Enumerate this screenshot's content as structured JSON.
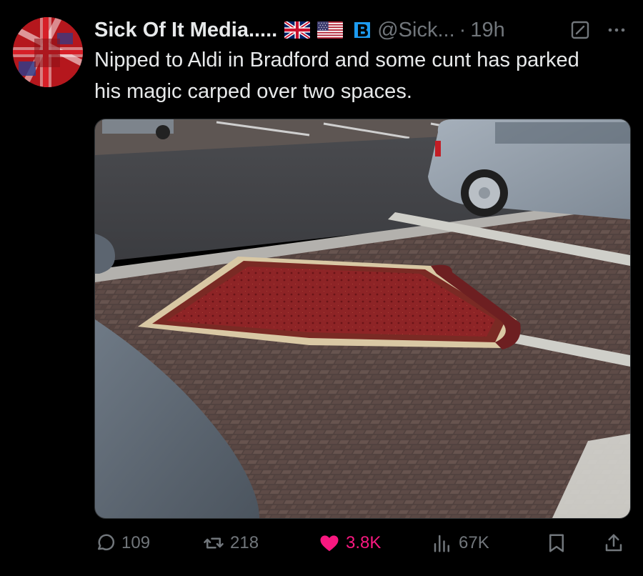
{
  "author": {
    "name": "Sick Of It Media.....",
    "handle": "@Sick...",
    "separator": "·",
    "time": "19h"
  },
  "tweet": {
    "text": "Nipped to Aldi in Bradford and some cunt has parked his magic carped over two spaces."
  },
  "icons": {
    "flags": [
      "uk-flag-icon",
      "us-flag-icon"
    ],
    "badge": "b-badge-icon",
    "grok": "grok-icon",
    "more": "more-icon",
    "actions": [
      "reply-icon",
      "retweet-icon",
      "heart-icon",
      "views-icon",
      "bookmark-icon",
      "share-icon"
    ]
  },
  "stats": {
    "replies": "109",
    "retweets": "218",
    "likes": "3.8K",
    "views": "67K"
  },
  "colors": {
    "background": "#000000",
    "text": "#e7e9ea",
    "muted": "#71767b",
    "like": "#f91880",
    "badge": "#1d9bf0"
  }
}
